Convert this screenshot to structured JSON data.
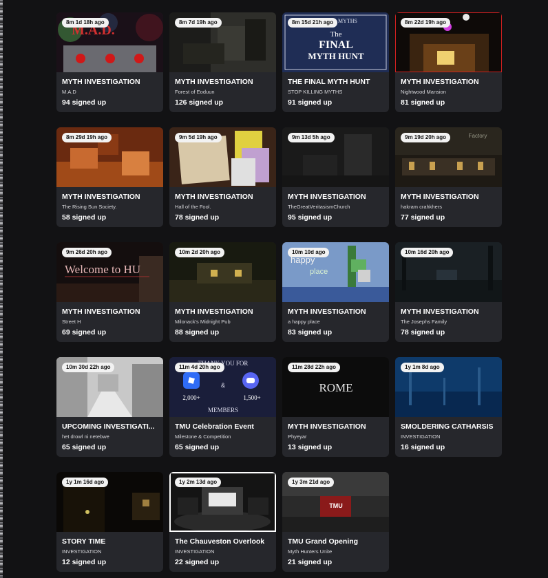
{
  "thumb_text": {
    "mad": "M.A.D.",
    "final_top": "MYTHS",
    "final_the": "The",
    "final_l1": "FINAL",
    "final_l2": "MYTH HUNT",
    "welcome": "Welcome to HU",
    "happy1": "happy",
    "happy2": "place",
    "thanks": "THANK YOU FOR",
    "amp": "&",
    "count_a": "2,000+",
    "count_b": "1,500+",
    "members": "MEMBERS",
    "rome": "ROME",
    "tmu": "TMU",
    "factory": "Factory"
  },
  "cards": [
    {
      "badge": "8m 1d 18h ago",
      "title": "MYTH INVESTIGATION",
      "sub": "M.A.D",
      "count": "94 signed up"
    },
    {
      "badge": "8m 7d 19h ago",
      "title": "MYTH INVESTIGATION",
      "sub": "Forest of Eoduun",
      "count": "126 signed up"
    },
    {
      "badge": "8m 15d 21h ago",
      "title": "THE FINAL MYTH HUNT",
      "sub": "STOP KILLING MYTHS",
      "count": "91 signed up"
    },
    {
      "badge": "8m 22d 19h ago",
      "title": "MYTH INVESTIGATION",
      "sub": "Nightwood Mansion",
      "count": "81 signed up"
    },
    {
      "badge": "8m 29d 19h ago",
      "title": "MYTH INVESTIGATION",
      "sub": "The Rising Sun Society.",
      "count": "58 signed up"
    },
    {
      "badge": "9m 5d 19h ago",
      "title": "MYTH INVESTIGATION",
      "sub": "Hall of the Fool.",
      "count": "78 signed up"
    },
    {
      "badge": "9m 13d 5h ago",
      "title": "MYTH INVESTIGATION",
      "sub": "TheGreatVeritasismChurch",
      "count": "95 signed up"
    },
    {
      "badge": "9m 19d 20h ago",
      "title": "MYTH INVESTIGATION",
      "sub": "hakram crahkhers",
      "count": "77 signed up"
    },
    {
      "badge": "9m 26d 20h ago",
      "title": "MYTH INVESTIGATION",
      "sub": "Street H",
      "count": "69 signed up"
    },
    {
      "badge": "10m 2d 20h ago",
      "title": "MYTH INVESTIGATION",
      "sub": "Milonack's Midnight Pub",
      "count": "88 signed up"
    },
    {
      "badge": "10m 10d ago",
      "title": "MYTH INVESTIGATION",
      "sub": "a happy place",
      "count": "83 signed up"
    },
    {
      "badge": "10m 16d 20h ago",
      "title": "MYTH INVESTIGATION",
      "sub": "The Josephs Family",
      "count": "78 signed up"
    },
    {
      "badge": "10m 30d 22h ago",
      "title": "UPCOMING INVESTIGATI...",
      "sub": "het drowl ni netebwe",
      "count": "65 signed up"
    },
    {
      "badge": "11m 4d 20h ago",
      "title": "TMU Celebration Event",
      "sub": "Milestone & Competition",
      "count": "65 signed up"
    },
    {
      "badge": "11m 28d 22h ago",
      "title": "MYTH INVESTIGATION",
      "sub": "Phyeyar",
      "count": "13 signed up"
    },
    {
      "badge": "1y 1m 8d ago",
      "title": "SMOLDERING CATHARSIS",
      "sub": "INVESTIGATION",
      "count": "16 signed up"
    },
    {
      "badge": "1y 1m 16d ago",
      "title": "STORY TIME",
      "sub": "INVESTIGATION",
      "count": "12 signed up"
    },
    {
      "badge": "1y 2m 13d ago",
      "title": "The Chauveston Overlook",
      "sub": "INVESTIGATION",
      "count": "22 signed up"
    },
    {
      "badge": "1y 3m 21d ago",
      "title": "TMU Grand Opening",
      "sub": "Myth Hunters Unite",
      "count": "21 signed up"
    }
  ]
}
